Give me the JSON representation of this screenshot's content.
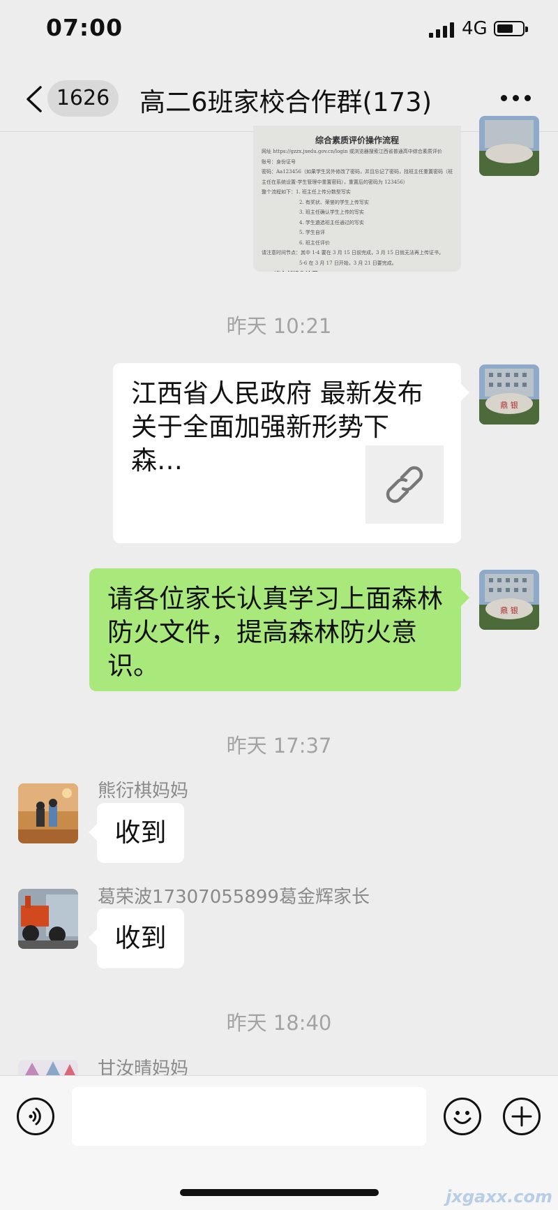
{
  "status_bar": {
    "time": "07:00",
    "network": "4G"
  },
  "nav": {
    "unread_count": "1626",
    "title": "高二6班家校合作群(173)"
  },
  "document_image": {
    "title": "综合素质评价操作流程",
    "lines": [
      "网址 https://gzzx.jxedu.gov.cn/login 或浏览器搜索江西省普通高中综合素质评价",
      "账号：身份证号",
      "密码：Aa123456（如果学生另外修改了密码，并且忘记了密码，找班主任重置密码（班",
      "主任在系统设置-学生管理中重置密码），重置后的密码为 123456）",
      "整个流程如下：1. 班主任上传分数型写实",
      "2. 有奖状、荣誉的学生上传写实",
      "3. 班主任确认学生上传的写实",
      "4. 学生遴选班主任通过的写实",
      "5. 学生自评",
      "6. 班主任评价",
      "请注意时间节点：其中 1-4 要在 3 月 15 日前完成，3 月 15 日就无法再上传证书，",
      "5-6 在 3 月 17 日开始，3 月 21 日要完成。",
      "二、班主任操作流程"
    ]
  },
  "messages": {
    "ts1": "昨天 10:21",
    "link_title": "江西省人民政府 最新发布关于全面加强新形势下森…",
    "text_green": "请各位家长认真学习上面森林防火文件，提高森林防火意识。",
    "ts2": "昨天 17:37",
    "sender1": "熊衍棋妈妈",
    "reply1": "收到",
    "sender2": "葛荣波17307055899葛金辉家长",
    "reply2": "收到",
    "ts3": "昨天 18:40",
    "sender3": "甘汝晴妈妈"
  },
  "avatar_text": {
    "self_stone": "鼎 银"
  },
  "watermark": "jxgaxx.com",
  "icons": [
    "back-chevron-icon",
    "more-dots-icon",
    "voice-icon",
    "emoji-icon",
    "plus-icon",
    "link-icon"
  ],
  "colors": {
    "background": "#ededed",
    "green_bubble": "#a9e87a",
    "white_bubble": "#ffffff",
    "timestamp": "#a3a3a3"
  }
}
